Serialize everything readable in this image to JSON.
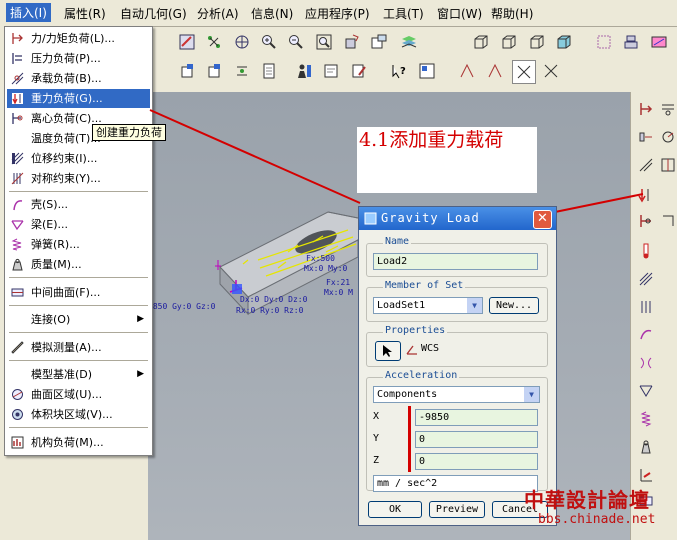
{
  "menubar": {
    "items": [
      "插入(I)",
      "属性(R)",
      "自动几何(G)",
      "分析(A)",
      "信息(N)",
      "应用程序(P)",
      "工具(T)",
      "窗口(W)",
      "帮助(H)"
    ]
  },
  "insert_menu": {
    "items": [
      {
        "label": "力/力矩负荷(L)...",
        "icon": "force-moment-icon"
      },
      {
        "label": "压力负荷(P)...",
        "icon": "pressure-load-icon"
      },
      {
        "label": "承载负荷(B)...",
        "icon": "bearing-load-icon"
      },
      {
        "label": "重力负荷(G)...",
        "icon": "gravity-load-icon"
      },
      {
        "label": "离心负荷(C)...",
        "icon": "centrifugal-load-icon"
      },
      {
        "label": "温度负荷(T)...",
        "icon": ""
      },
      {
        "label": "位移约束(I)...",
        "icon": "displacement-constraint-icon"
      },
      {
        "label": "对称约束(Y)...",
        "icon": "symmetry-constraint-icon"
      },
      {
        "label": "壳(S)...",
        "icon": "shell-icon"
      },
      {
        "label": "梁(E)...",
        "icon": "beam-icon"
      },
      {
        "label": "弹簧(R)...",
        "icon": "spring-icon"
      },
      {
        "label": "质量(M)...",
        "icon": "mass-icon"
      },
      {
        "label": "中间曲面(F)...",
        "icon": "midsurface-icon"
      },
      {
        "label": "连接(O)",
        "icon": ""
      },
      {
        "label": "模拟测量(A)...",
        "icon": "simulation-measure-icon"
      },
      {
        "label": "模型基准(D)",
        "icon": ""
      },
      {
        "label": "曲面区域(U)...",
        "icon": "surface-region-icon"
      },
      {
        "label": "体积块区域(V)...",
        "icon": "volume-region-icon"
      },
      {
        "label": "机构负荷(M)...",
        "icon": "mechanism-load-icon"
      }
    ],
    "highlighted_index": 3
  },
  "tooltip": "创建重力负荷",
  "annotation": "4.1添加重力载荷",
  "model_labels": {
    "left": "9850 Gy:0 Gz:0",
    "row1": "Dx:0 Dy:0 Dz:0",
    "row2": "Rx:0 Ry:0 Rz:0",
    "fx1": "Fx:500",
    "mx": "Mx:0 My:0",
    "fx2": "Fx:21",
    "mx2": "Mx:0 M"
  },
  "dialog": {
    "title": "Gravity Load",
    "name_label": "Name",
    "name_value": "Load2",
    "member_label": "Member of Set",
    "member_value": "LoadSet1",
    "new_button": "New...",
    "properties_label": "Properties",
    "csys": "WCS",
    "accel_label": "Acceleration",
    "accel_mode": "Components",
    "x_label": "X",
    "x_value": "-9850",
    "y_label": "Y",
    "y_value": "0",
    "z_label": "Z",
    "z_value": "0",
    "units": "mm / sec^2",
    "ok": "OK",
    "preview": "Preview",
    "cancel": "Cancel"
  },
  "watermark": {
    "line1": "中華設計論壇",
    "line2": "bbs.chinade.net"
  },
  "colors": {
    "menu_highlight": "#316ac5",
    "annotation_red": "#d40000",
    "title_blue": "#2266cc"
  }
}
